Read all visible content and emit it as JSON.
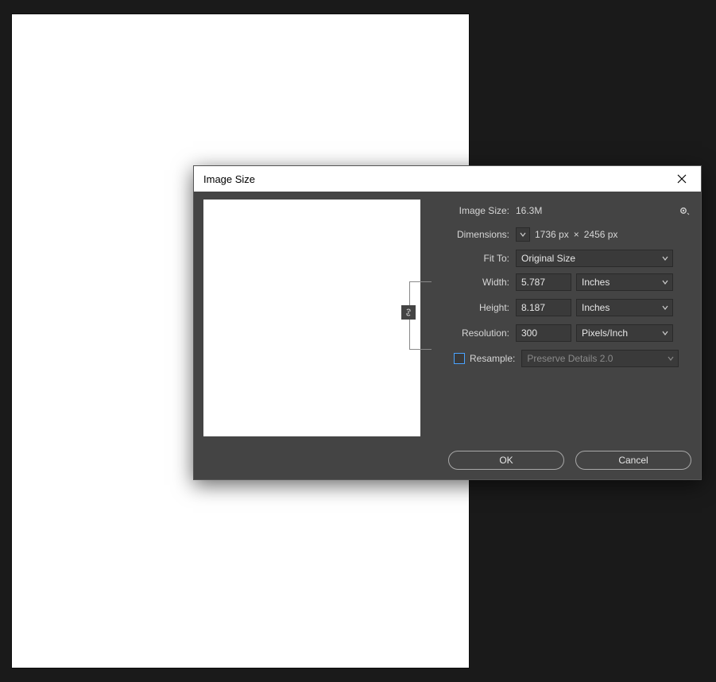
{
  "dialog": {
    "title": "Image Size",
    "image_size_label": "Image Size:",
    "image_size_value": "16.3M",
    "dimensions_label": "Dimensions:",
    "dimensions_w": "1736 px",
    "dimensions_h": "2456 px",
    "fit_to_label": "Fit To:",
    "fit_to_value": "Original Size",
    "width_label": "Width:",
    "width_value": "5.787",
    "width_unit": "Inches",
    "height_label": "Height:",
    "height_value": "8.187",
    "height_unit": "Inches",
    "resolution_label": "Resolution:",
    "resolution_value": "300",
    "resolution_unit": "Pixels/Inch",
    "resample_label": "Resample:",
    "resample_method": "Preserve Details 2.0",
    "ok_label": "OK",
    "cancel_label": "Cancel"
  }
}
